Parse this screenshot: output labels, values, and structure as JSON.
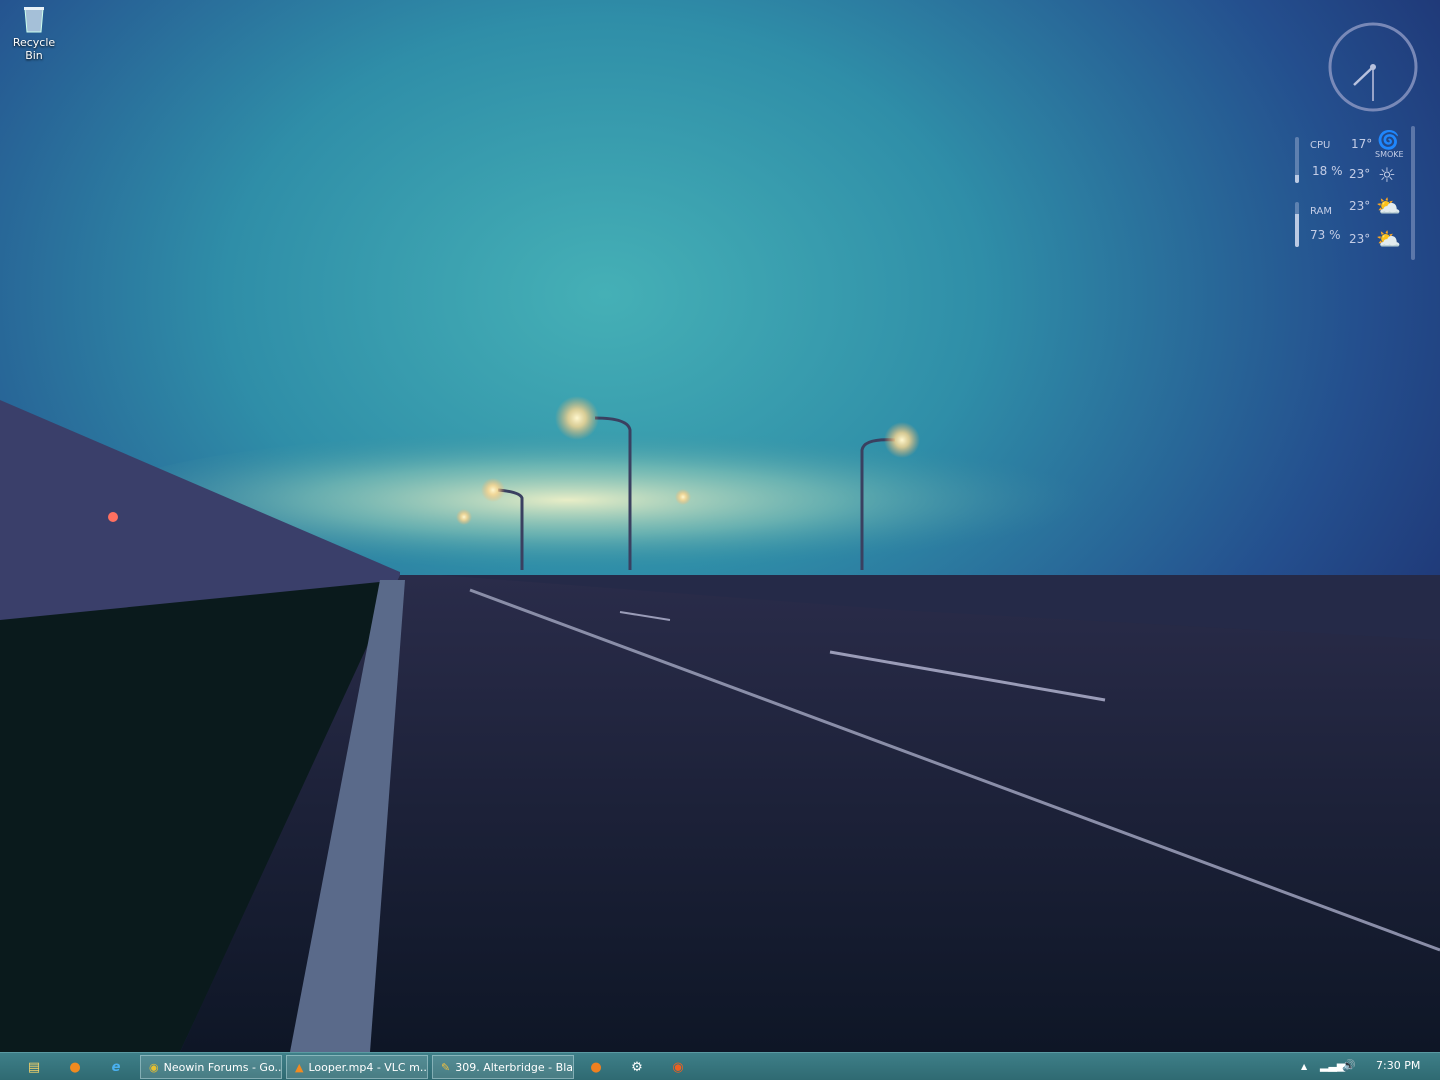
{
  "desktop": {
    "icons": [
      {
        "label": "Recycle Bin",
        "icon": "recycle-bin-icon"
      }
    ]
  },
  "clock_widget": {
    "hour": 7,
    "minute": 30
  },
  "system_widget": {
    "cpu": {
      "label": "CPU",
      "value": "18 %",
      "percent": 18
    },
    "ram": {
      "label": "RAM",
      "value": "73 %",
      "percent": 73
    }
  },
  "weather_widget": {
    "rows": [
      {
        "temp": "17°",
        "icon": "smoke-icon",
        "condition": "SMOKE"
      },
      {
        "temp": "23°",
        "icon": "sun-icon"
      },
      {
        "temp": "23°",
        "icon": "partly-cloudy-icon"
      },
      {
        "temp": "23°",
        "icon": "partly-cloudy-icon"
      }
    ]
  },
  "taskbar": {
    "pinned": [
      "file-explorer-icon",
      "firefox-icon",
      "internet-explorer-icon"
    ],
    "tasks": [
      {
        "label": "Neowin Forums - Go...",
        "icon": "chrome-icon"
      },
      {
        "label": "Looper.mp4 - VLC m...",
        "icon": "vlc-icon"
      },
      {
        "label": "309. Alterbridge - Bla...",
        "icon": "foobar-icon"
      }
    ],
    "pinned_after": [
      "media-player-icon",
      "steam-icon",
      "origin-icon"
    ],
    "tray": {
      "time": "7:30 PM"
    }
  }
}
